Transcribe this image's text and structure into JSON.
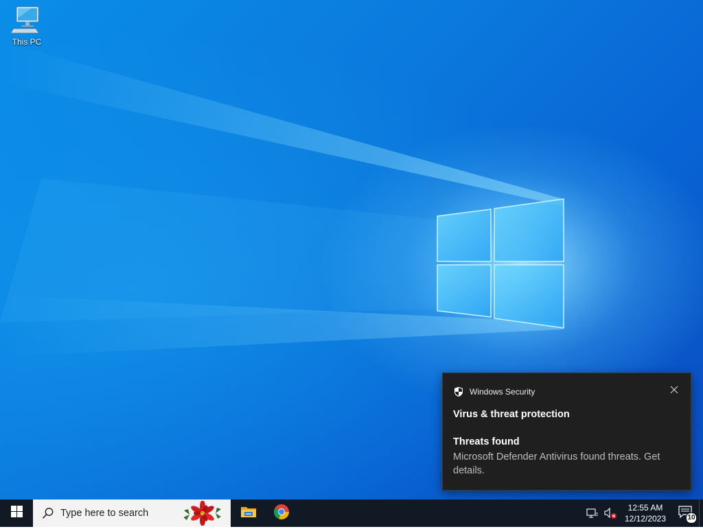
{
  "desktop": {
    "icons": [
      {
        "label": "This PC",
        "icon": "computer-icon"
      }
    ]
  },
  "toast": {
    "app_name": "Windows Security",
    "app_icon": "shield-icon",
    "close_icon": "close-icon",
    "title": "Virus & threat protection",
    "subtitle": "Threats found",
    "body": "Microsoft Defender Antivirus found threats. Get details."
  },
  "taskbar": {
    "start_icon": "windows-logo-icon",
    "search_placeholder": "Type here to search",
    "pinned_apps": [
      {
        "name": "File Explorer",
        "icon": "folder-icon"
      },
      {
        "name": "Google Chrome",
        "icon": "chrome-icon"
      }
    ],
    "tray": {
      "network_icon": "network-disconnected-icon",
      "volume_icon": "volume-muted-icon",
      "time": "12:55 AM",
      "date": "12/12/2023",
      "notification_count": "10"
    }
  },
  "colors": {
    "accent": "#0a79dd",
    "taskbar": "#111a24",
    "toast_bg": "#1f1f1f"
  }
}
